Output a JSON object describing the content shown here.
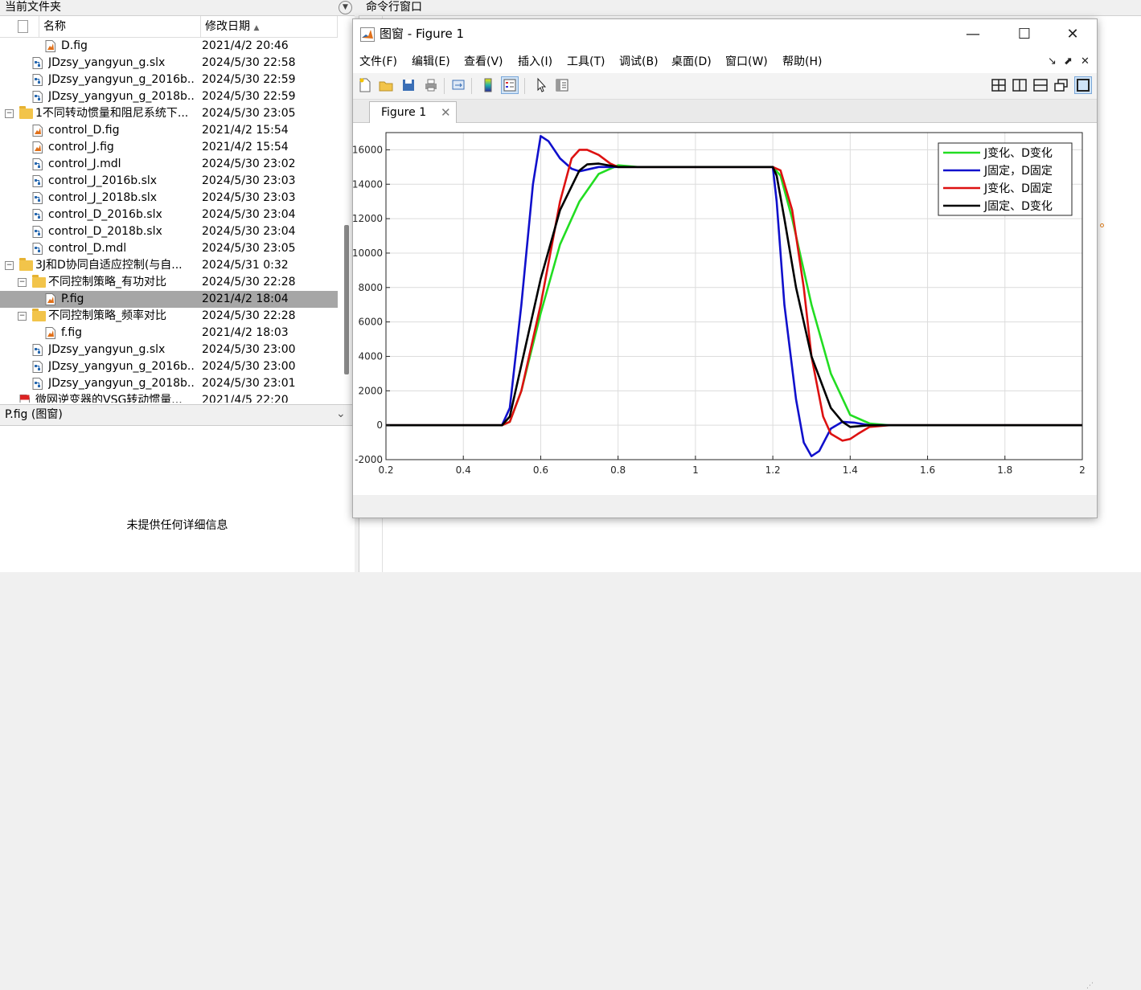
{
  "current_folder": {
    "title": "当前文件夹",
    "col_name": "名称",
    "col_date": "修改日期",
    "rows": [
      {
        "name": "D.fig",
        "date": "2021/4/2 20:46",
        "type": "fig",
        "indent": 2,
        "toggle": "",
        "selected": false
      },
      {
        "name": "JDzsy_yangyun_g.slx",
        "date": "2024/5/30 22:58",
        "type": "slx",
        "indent": 1,
        "toggle": "",
        "selected": false
      },
      {
        "name": "JDzsy_yangyun_g_2016b..",
        "date": "2024/5/30 22:59",
        "type": "slx",
        "indent": 1,
        "toggle": "",
        "selected": false
      },
      {
        "name": "JDzsy_yangyun_g_2018b..",
        "date": "2024/5/30 22:59",
        "type": "slx",
        "indent": 1,
        "toggle": "",
        "selected": false
      },
      {
        "name": "1不同转动惯量和阻尼系统下...",
        "date": "2024/5/30 23:05",
        "type": "folder",
        "indent": 0,
        "toggle": "−",
        "selected": false
      },
      {
        "name": "control_D.fig",
        "date": "2021/4/2 15:54",
        "type": "fig",
        "indent": 1,
        "toggle": "",
        "selected": false
      },
      {
        "name": "control_J.fig",
        "date": "2021/4/2 15:54",
        "type": "fig",
        "indent": 1,
        "toggle": "",
        "selected": false
      },
      {
        "name": "control_J.mdl",
        "date": "2024/5/30 23:02",
        "type": "slx",
        "indent": 1,
        "toggle": "",
        "selected": false
      },
      {
        "name": "control_J_2016b.slx",
        "date": "2024/5/30 23:03",
        "type": "slx",
        "indent": 1,
        "toggle": "",
        "selected": false
      },
      {
        "name": "control_J_2018b.slx",
        "date": "2024/5/30 23:03",
        "type": "slx",
        "indent": 1,
        "toggle": "",
        "selected": false
      },
      {
        "name": "control_D_2016b.slx",
        "date": "2024/5/30 23:04",
        "type": "slx",
        "indent": 1,
        "toggle": "",
        "selected": false
      },
      {
        "name": "control_D_2018b.slx",
        "date": "2024/5/30 23:04",
        "type": "slx",
        "indent": 1,
        "toggle": "",
        "selected": false
      },
      {
        "name": "control_D.mdl",
        "date": "2024/5/30 23:05",
        "type": "slx",
        "indent": 1,
        "toggle": "",
        "selected": false
      },
      {
        "name": "3J和D协同自适应控制(与自...",
        "date": "2024/5/31 0:32",
        "type": "folder",
        "indent": 0,
        "toggle": "−",
        "selected": false
      },
      {
        "name": "不同控制策略_有功对比",
        "date": "2024/5/30 22:28",
        "type": "folder",
        "indent": 1,
        "toggle": "−",
        "selected": false
      },
      {
        "name": "P.fig",
        "date": "2021/4/2 18:04",
        "type": "fig",
        "indent": 2,
        "toggle": "",
        "selected": true
      },
      {
        "name": "不同控制策略_频率对比",
        "date": "2024/5/30 22:28",
        "type": "folder",
        "indent": 1,
        "toggle": "−",
        "selected": false
      },
      {
        "name": "f.fig",
        "date": "2021/4/2 18:03",
        "type": "fig",
        "indent": 2,
        "toggle": "",
        "selected": false
      },
      {
        "name": "JDzsy_yangyun_g.slx",
        "date": "2024/5/30 23:00",
        "type": "slx",
        "indent": 1,
        "toggle": "",
        "selected": false
      },
      {
        "name": "JDzsy_yangyun_g_2016b..",
        "date": "2024/5/30 23:00",
        "type": "slx",
        "indent": 1,
        "toggle": "",
        "selected": false
      },
      {
        "name": "JDzsy_yangyun_g_2018b..",
        "date": "2024/5/30 23:01",
        "type": "slx",
        "indent": 1,
        "toggle": "",
        "selected": false
      },
      {
        "name": "微网逆变器的VSG转动惯量...",
        "date": "2021/4/5 22:20",
        "type": "pdf",
        "indent": 0,
        "toggle": "",
        "selected": false
      }
    ],
    "detail_title": "P.fig  (图窗)",
    "detail_text": "未提供任何详细信息"
  },
  "command_window": {
    "title": "命令行窗口"
  },
  "figure": {
    "window_title": "图窗 - Figure 1",
    "menu": [
      "文件(F)",
      "编辑(E)",
      "查看(V)",
      "插入(I)",
      "工具(T)",
      "调试(B)",
      "桌面(D)",
      "窗口(W)",
      "帮助(H)"
    ],
    "tab_label": "Figure 1",
    "toolbar_icons": [
      "new-figure-icon",
      "open-file-icon",
      "save-icon",
      "print-icon",
      "link-icon",
      "colorbar-icon",
      "legend-icon",
      "pointer-icon",
      "property-editor-icon"
    ],
    "layout_icons": [
      "tile-grid-icon",
      "tile-columns-icon",
      "tile-rows-icon",
      "float-icon",
      "maximize-icon"
    ],
    "colors": {
      "green": "#22dd22",
      "blue": "#1010cc",
      "red": "#dd1111",
      "black": "#000000"
    }
  },
  "chart_data": {
    "type": "line",
    "title": "",
    "xlabel": "",
    "ylabel": "",
    "xlim": [
      0.2,
      2
    ],
    "ylim": [
      -2000,
      17000
    ],
    "xticks": [
      0.2,
      0.4,
      0.6,
      0.8,
      1,
      1.2,
      1.4,
      1.6,
      1.8,
      2
    ],
    "yticks": [
      -2000,
      0,
      2000,
      4000,
      6000,
      8000,
      10000,
      12000,
      14000,
      16000
    ],
    "xtick_labels": [
      "0.2",
      "0.4",
      "0.6",
      "0.8",
      "1",
      "1.2",
      "1.4",
      "1.6",
      "1.8",
      "2"
    ],
    "ytick_labels": [
      "-2000",
      "0",
      "2000",
      "4000",
      "6000",
      "8000",
      "10000",
      "12000",
      "14000",
      "16000"
    ],
    "grid": true,
    "legend_position": "top-right",
    "series": [
      {
        "name": "J变化、D变化",
        "color": "#22dd22",
        "x": [
          0.2,
          0.5,
          0.52,
          0.55,
          0.6,
          0.65,
          0.7,
          0.75,
          0.8,
          0.85,
          1.2,
          1.22,
          1.25,
          1.3,
          1.35,
          1.4,
          1.45,
          1.5,
          2.0
        ],
        "y": [
          0,
          0,
          200,
          2000,
          6500,
          10500,
          13000,
          14600,
          15100,
          15000,
          15000,
          14500,
          12000,
          7000,
          3000,
          600,
          100,
          0,
          0
        ]
      },
      {
        "name": "J固定，D固定",
        "color": "#1010cc",
        "x": [
          0.2,
          0.5,
          0.52,
          0.55,
          0.58,
          0.6,
          0.62,
          0.65,
          0.68,
          0.7,
          0.75,
          0.8,
          1.2,
          1.21,
          1.23,
          1.26,
          1.28,
          1.3,
          1.32,
          1.35,
          1.38,
          1.41,
          1.45,
          1.5,
          2.0
        ],
        "y": [
          0,
          0,
          1000,
          7000,
          14000,
          16800,
          16500,
          15500,
          14900,
          14750,
          15000,
          15000,
          15000,
          13000,
          7000,
          1500,
          -1000,
          -1800,
          -1500,
          -200,
          200,
          150,
          0,
          0,
          0
        ]
      },
      {
        "name": "J变化、D固定",
        "color": "#dd1111",
        "x": [
          0.2,
          0.5,
          0.52,
          0.55,
          0.6,
          0.65,
          0.68,
          0.7,
          0.72,
          0.75,
          0.78,
          0.8,
          0.85,
          1.2,
          1.22,
          1.25,
          1.28,
          1.3,
          1.33,
          1.35,
          1.38,
          1.4,
          1.42,
          1.45,
          1.5,
          2.0
        ],
        "y": [
          0,
          0,
          200,
          2000,
          7000,
          13000,
          15500,
          16000,
          16000,
          15700,
          15200,
          15000,
          15000,
          15000,
          14800,
          12500,
          8000,
          4000,
          500,
          -500,
          -900,
          -800,
          -500,
          -100,
          0,
          0
        ]
      },
      {
        "name": "J固定、D变化",
        "color": "#000000",
        "x": [
          0.2,
          0.5,
          0.52,
          0.55,
          0.6,
          0.65,
          0.7,
          0.72,
          0.75,
          0.8,
          1.2,
          1.21,
          1.23,
          1.26,
          1.3,
          1.35,
          1.38,
          1.4,
          1.45,
          1.5,
          2.0
        ],
        "y": [
          0,
          0,
          500,
          3500,
          8500,
          12500,
          14800,
          15150,
          15200,
          15000,
          15000,
          14500,
          12000,
          8000,
          4000,
          1000,
          200,
          -100,
          0,
          0,
          0
        ]
      }
    ]
  }
}
